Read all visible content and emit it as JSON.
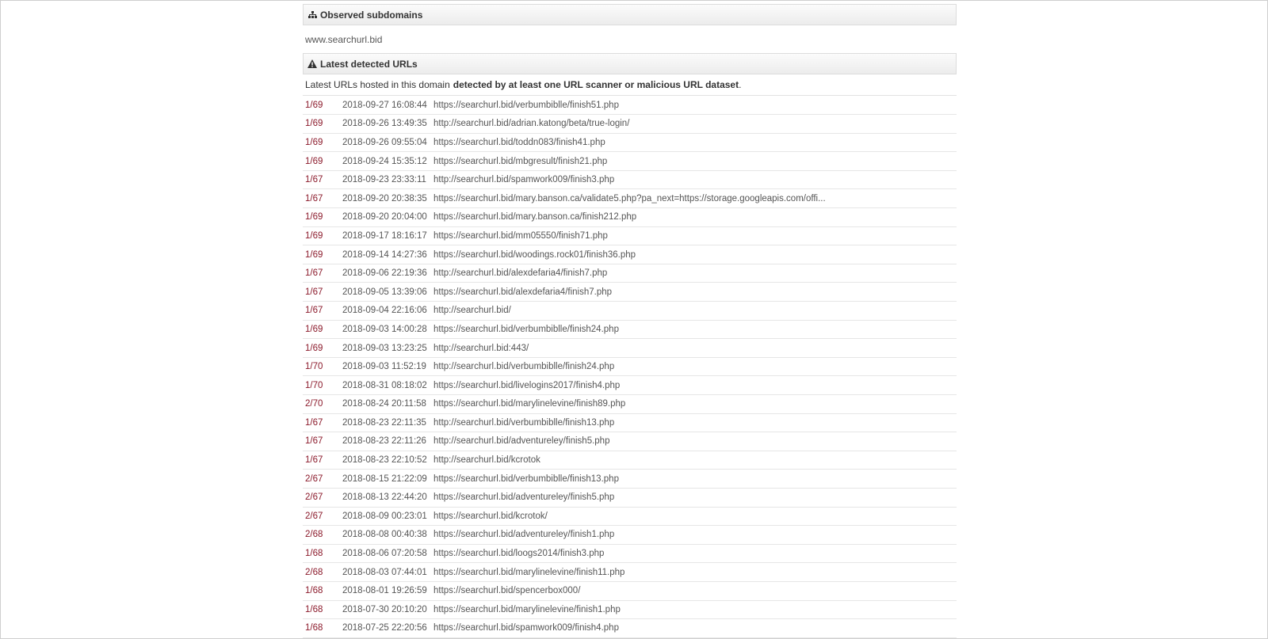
{
  "subdomains_section": {
    "title": "Observed subdomains",
    "icon": "sitemap-icon",
    "items": [
      "www.searchurl.bid"
    ]
  },
  "urls_section": {
    "title": "Latest detected URLs",
    "icon": "warning-icon",
    "intro_prefix": "Latest URLs hosted in this domain",
    "intro_bold": "detected by at least one URL scanner or malicious URL dataset",
    "intro_suffix": ".",
    "ratio_color": "#8b1a2b",
    "rows": [
      {
        "ratio": "1/69",
        "date": "2018-09-27 16:08:44",
        "url": "https://searchurl.bid/verbumbiblle/finish51.php"
      },
      {
        "ratio": "1/69",
        "date": "2018-09-26 13:49:35",
        "url": "http://searchurl.bid/adrian.katong/beta/true-login/"
      },
      {
        "ratio": "1/69",
        "date": "2018-09-26 09:55:04",
        "url": "https://searchurl.bid/toddn083/finish41.php"
      },
      {
        "ratio": "1/69",
        "date": "2018-09-24 15:35:12",
        "url": "https://searchurl.bid/mbgresult/finish21.php"
      },
      {
        "ratio": "1/67",
        "date": "2018-09-23 23:33:11",
        "url": "http://searchurl.bid/spamwork009/finish3.php"
      },
      {
        "ratio": "1/67",
        "date": "2018-09-20 20:38:35",
        "url": "https://searchurl.bid/mary.banson.ca/validate5.php?pa_next=https://storage.googleapis.com/offi..."
      },
      {
        "ratio": "1/69",
        "date": "2018-09-20 20:04:00",
        "url": "https://searchurl.bid/mary.banson.ca/finish212.php"
      },
      {
        "ratio": "1/69",
        "date": "2018-09-17 18:16:17",
        "url": "https://searchurl.bid/mm05550/finish71.php"
      },
      {
        "ratio": "1/69",
        "date": "2018-09-14 14:27:36",
        "url": "https://searchurl.bid/woodings.rock01/finish36.php"
      },
      {
        "ratio": "1/67",
        "date": "2018-09-06 22:19:36",
        "url": "http://searchurl.bid/alexdefaria4/finish7.php"
      },
      {
        "ratio": "1/67",
        "date": "2018-09-05 13:39:06",
        "url": "https://searchurl.bid/alexdefaria4/finish7.php"
      },
      {
        "ratio": "1/67",
        "date": "2018-09-04 22:16:06",
        "url": "http://searchurl.bid/"
      },
      {
        "ratio": "1/69",
        "date": "2018-09-03 14:00:28",
        "url": "https://searchurl.bid/verbumbiblle/finish24.php"
      },
      {
        "ratio": "1/69",
        "date": "2018-09-03 13:23:25",
        "url": "http://searchurl.bid:443/"
      },
      {
        "ratio": "1/70",
        "date": "2018-09-03 11:52:19",
        "url": "http://searchurl.bid/verbumbiblle/finish24.php"
      },
      {
        "ratio": "1/70",
        "date": "2018-08-31 08:18:02",
        "url": "https://searchurl.bid/livelogins2017/finish4.php"
      },
      {
        "ratio": "2/70",
        "date": "2018-08-24 20:11:58",
        "url": "https://searchurl.bid/marylinelevine/finish89.php"
      },
      {
        "ratio": "1/67",
        "date": "2018-08-23 22:11:35",
        "url": "http://searchurl.bid/verbumbiblle/finish13.php"
      },
      {
        "ratio": "1/67",
        "date": "2018-08-23 22:11:26",
        "url": "http://searchurl.bid/adventureley/finish5.php"
      },
      {
        "ratio": "1/67",
        "date": "2018-08-23 22:10:52",
        "url": "http://searchurl.bid/kcrotok"
      },
      {
        "ratio": "2/67",
        "date": "2018-08-15 21:22:09",
        "url": "https://searchurl.bid/verbumbiblle/finish13.php"
      },
      {
        "ratio": "2/67",
        "date": "2018-08-13 22:44:20",
        "url": "https://searchurl.bid/adventureley/finish5.php"
      },
      {
        "ratio": "2/67",
        "date": "2018-08-09 00:23:01",
        "url": "https://searchurl.bid/kcrotok/"
      },
      {
        "ratio": "2/68",
        "date": "2018-08-08 00:40:38",
        "url": "https://searchurl.bid/adventureley/finish1.php"
      },
      {
        "ratio": "1/68",
        "date": "2018-08-06 07:20:58",
        "url": "https://searchurl.bid/loogs2014/finish3.php"
      },
      {
        "ratio": "2/68",
        "date": "2018-08-03 07:44:01",
        "url": "https://searchurl.bid/marylinelevine/finish11.php"
      },
      {
        "ratio": "1/68",
        "date": "2018-08-01 19:26:59",
        "url": "https://searchurl.bid/spencerbox000/"
      },
      {
        "ratio": "1/68",
        "date": "2018-07-30 20:10:20",
        "url": "https://searchurl.bid/marylinelevine/finish1.php"
      },
      {
        "ratio": "1/68",
        "date": "2018-07-25 22:20:56",
        "url": "https://searchurl.bid/spamwork009/finish4.php"
      }
    ]
  }
}
